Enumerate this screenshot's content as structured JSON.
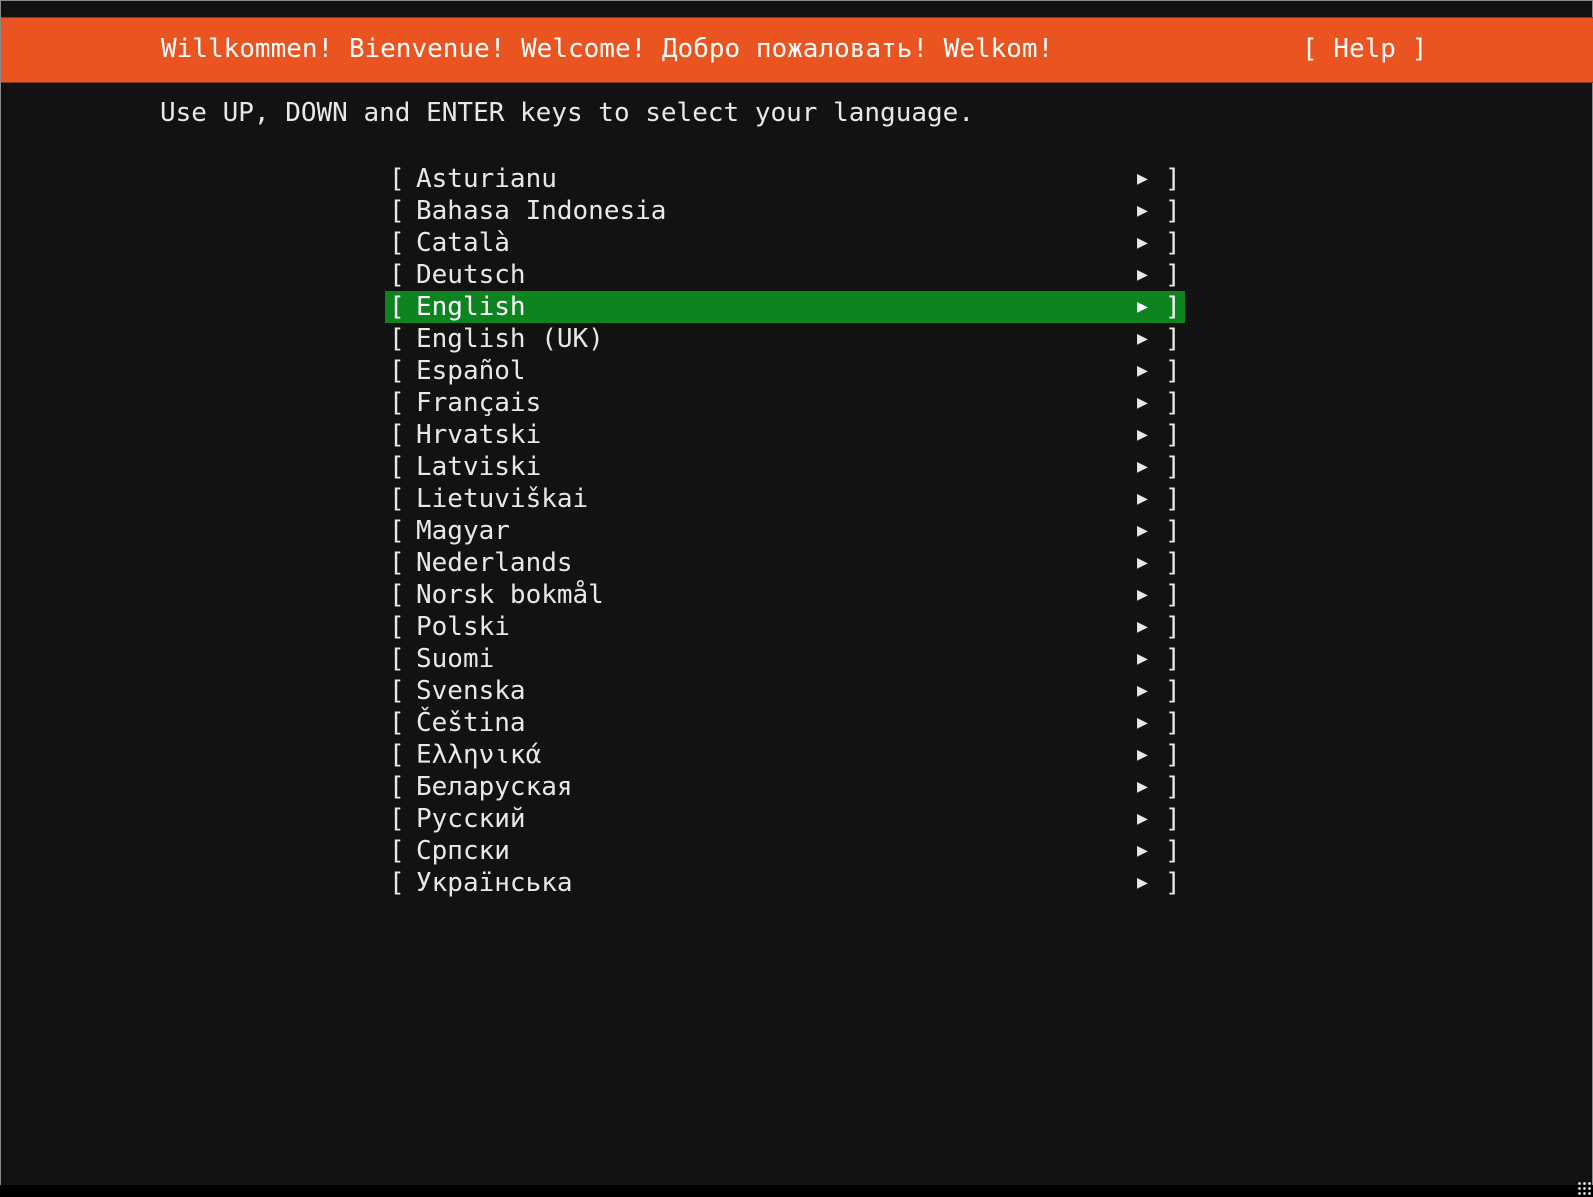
{
  "header": {
    "title": "Willkommen! Bienvenue! Welcome! Добро пожаловать! Welkom!",
    "help_label": "[ Help ]"
  },
  "instruction": "Use UP, DOWN and ENTER keys to select your language.",
  "colors": {
    "header": "#e95420",
    "selected": "#0e8420",
    "background": "#121212"
  },
  "languages": [
    {
      "label": "Asturianu"
    },
    {
      "label": "Bahasa Indonesia"
    },
    {
      "label": "Català"
    },
    {
      "label": "Deutsch"
    },
    {
      "label": "English",
      "selected": true
    },
    {
      "label": "English (UK)"
    },
    {
      "label": "Español"
    },
    {
      "label": "Français"
    },
    {
      "label": "Hrvatski"
    },
    {
      "label": "Latviski"
    },
    {
      "label": "Lietuviškai"
    },
    {
      "label": "Magyar"
    },
    {
      "label": "Nederlands"
    },
    {
      "label": "Norsk bokmål"
    },
    {
      "label": "Polski"
    },
    {
      "label": "Suomi"
    },
    {
      "label": "Svenska"
    },
    {
      "label": "Čeština"
    },
    {
      "label": "Ελληνικά"
    },
    {
      "label": "Беларуская"
    },
    {
      "label": "Русский"
    },
    {
      "label": "Српски"
    },
    {
      "label": "Українська"
    }
  ],
  "row_glyphs": {
    "left_bracket": "[",
    "arrow": "▶",
    "right_bracket": "]"
  }
}
